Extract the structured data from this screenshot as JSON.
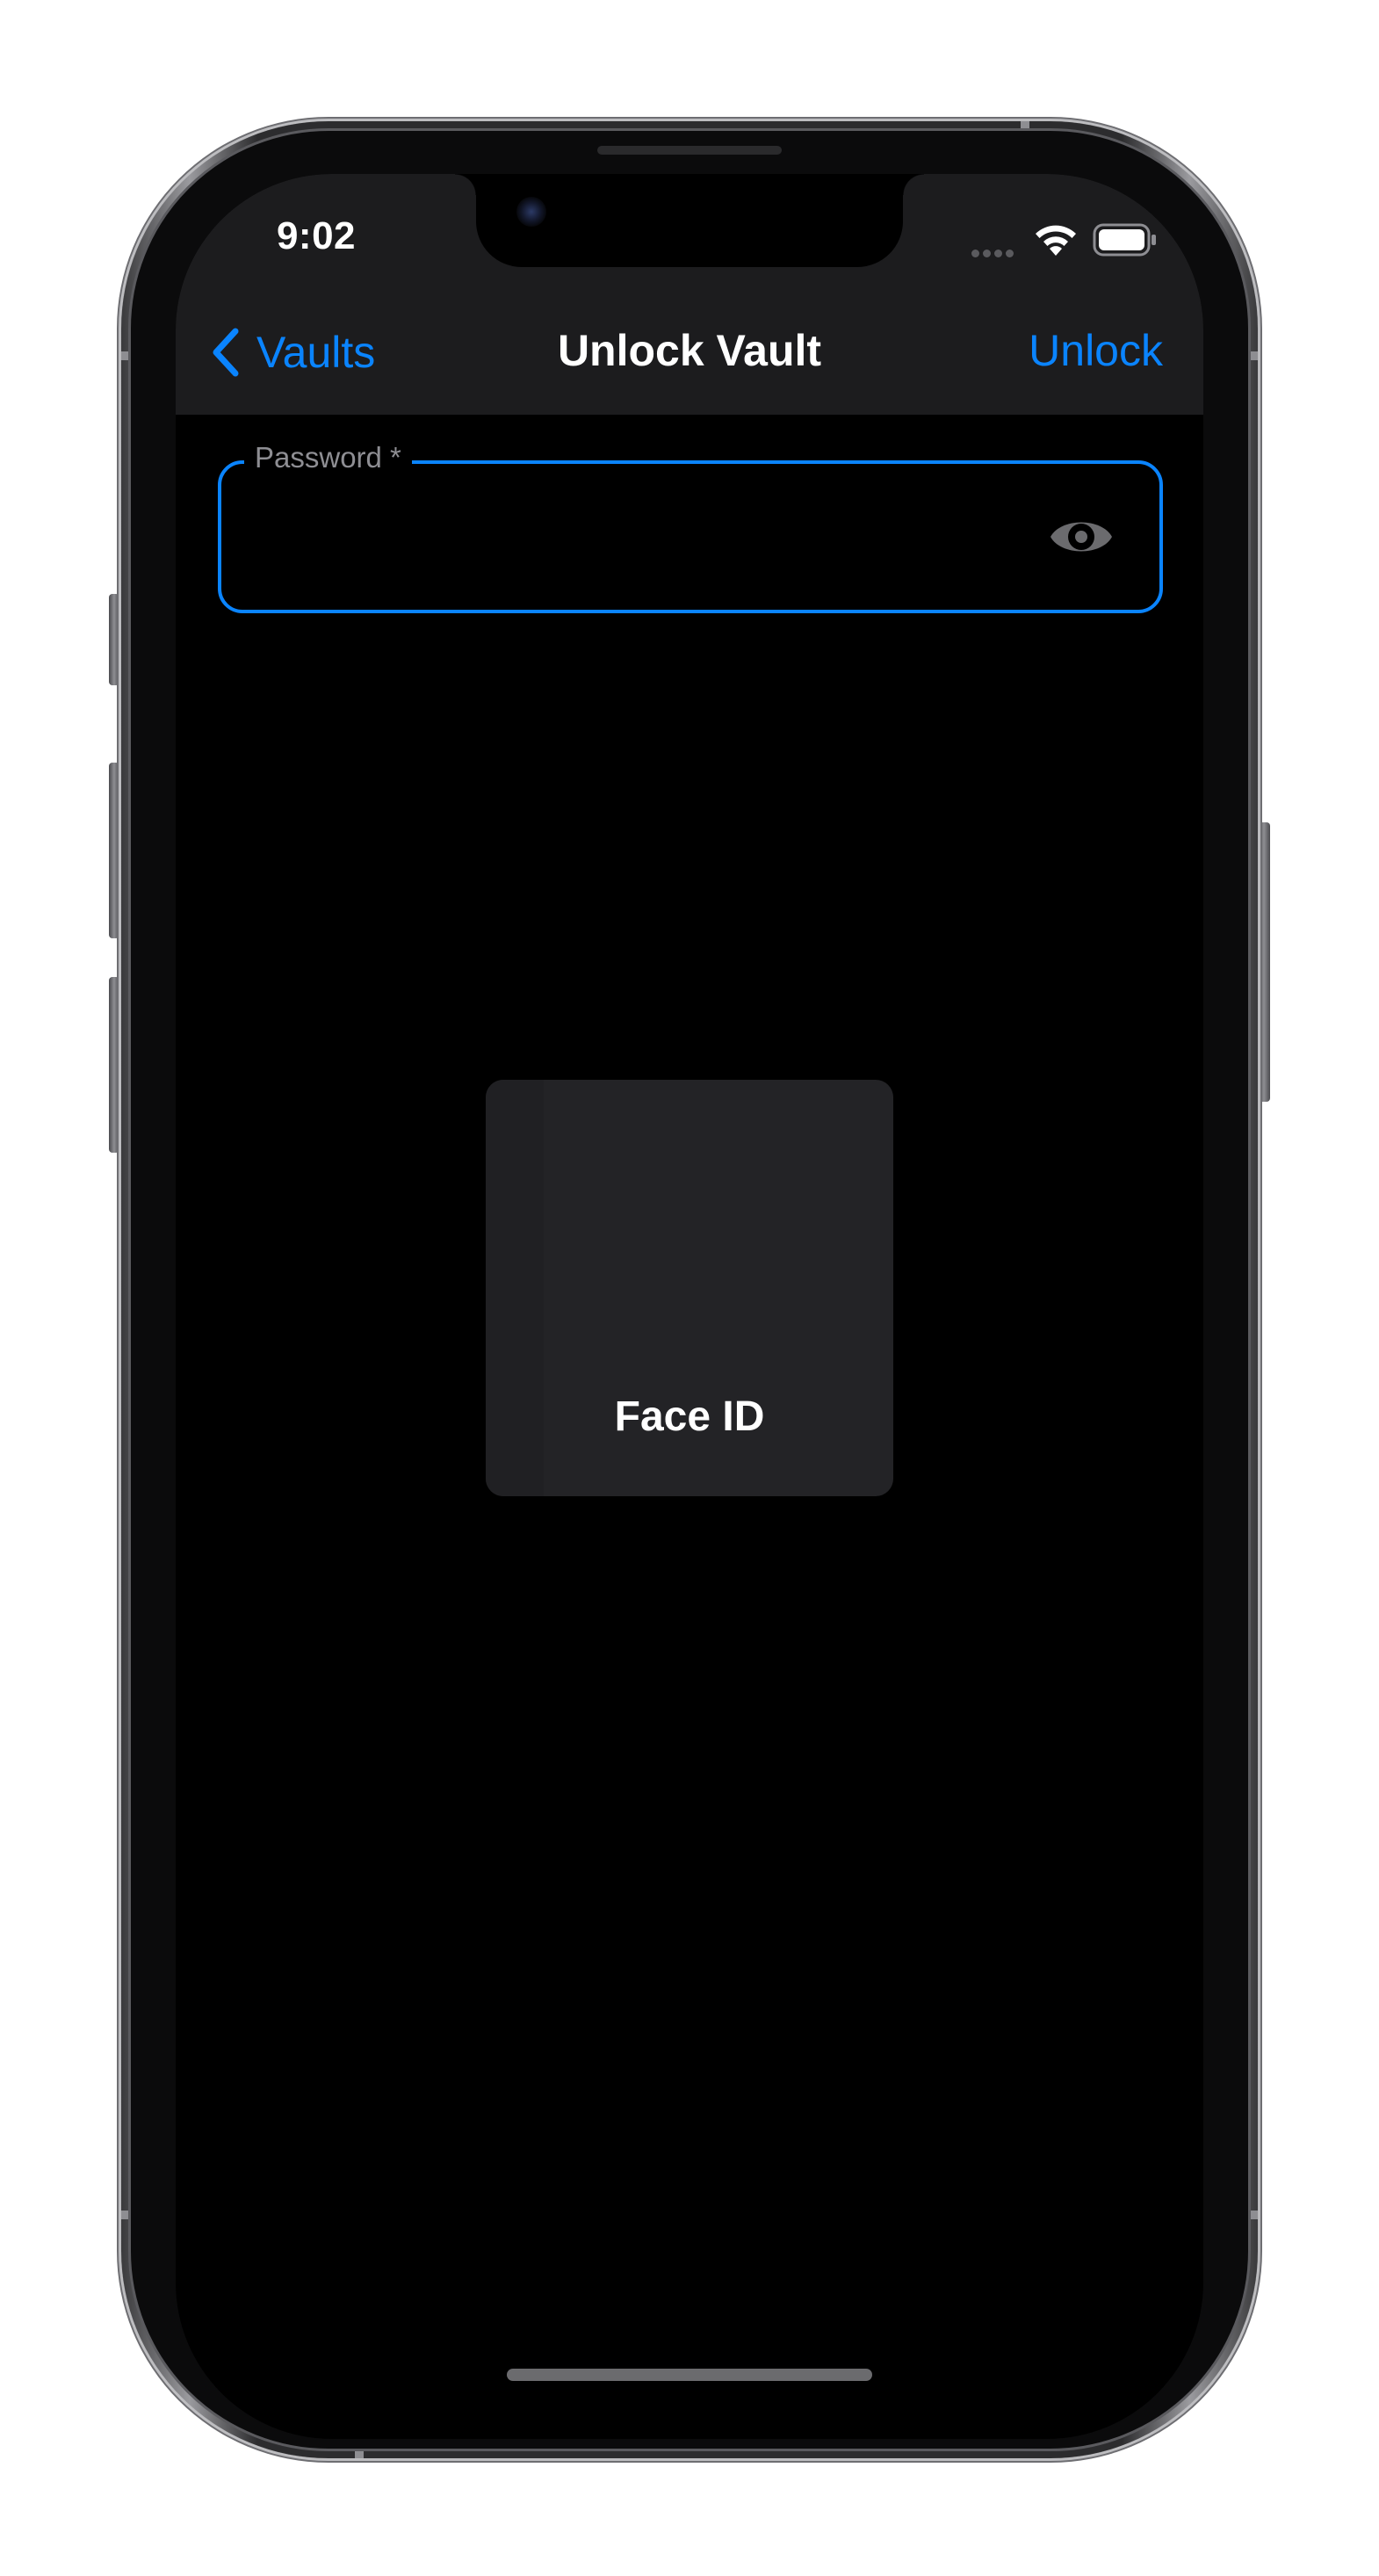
{
  "status_bar": {
    "time": "9:02",
    "signal_icon": "cellular-signal-icon",
    "wifi_icon": "wifi-icon",
    "battery_icon": "battery-icon"
  },
  "nav": {
    "back_label": "Vaults",
    "back_icon": "chevron-left-icon",
    "title": "Unlock Vault",
    "action_label": "Unlock"
  },
  "password_field": {
    "label": "Password *",
    "value": "",
    "visibility_icon": "eye-icon"
  },
  "face_id": {
    "label": "Face ID"
  },
  "colors": {
    "accent": "#0a84ff",
    "background": "#000000",
    "nav_background": "#1c1c1e",
    "card_background": "#232326",
    "label_gray": "#8e8e93"
  }
}
